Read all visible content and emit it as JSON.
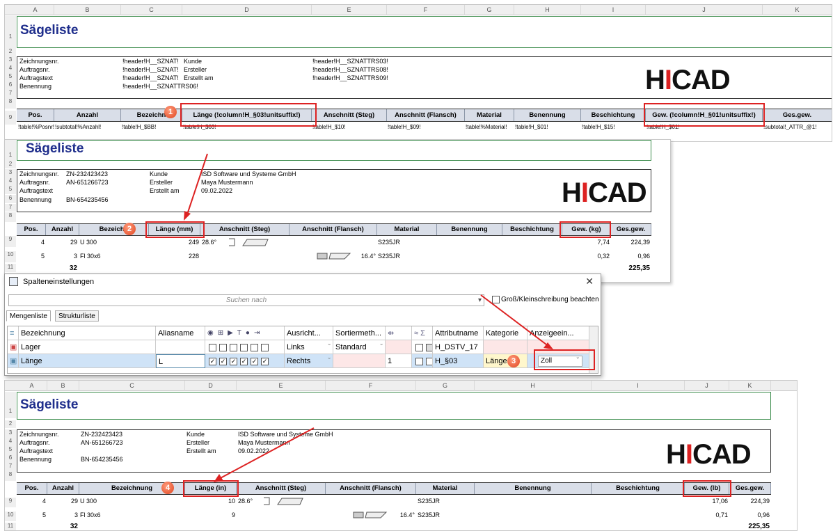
{
  "colors": {
    "title": "#1f2e8c",
    "red": "#dd2222",
    "header_bg": "#d9dee8"
  },
  "shot1": {
    "cols": [
      "A",
      "B",
      "C",
      "D",
      "E",
      "F",
      "G",
      "H",
      "I",
      "J",
      "K"
    ],
    "rownums": [
      "1",
      "2",
      "3",
      "4",
      "5",
      "6",
      "7",
      "8",
      "9"
    ],
    "title": "Sägeliste",
    "info": [
      [
        "Zeichnungsnr.",
        "!header!H__SZNAT!",
        "Kunde",
        "!header!H__SZNATTRS03!"
      ],
      [
        "Auftragsnr.",
        "!header!H__SZNAT!",
        "Ersteller",
        "!header!H__SZNATTRS08!"
      ],
      [
        "Auftragstext",
        "!header!H__SZNAT!",
        "Erstellt am",
        "!header!H__SZNATTRS09!"
      ],
      [
        "Benennung",
        "!header!H__SZNATTRS06!",
        "",
        ""
      ]
    ],
    "headers": [
      "Pos.",
      "Anzahl",
      "Bezeichn",
      "Länge (!column!H_§03!unitsuffix!)",
      "Anschnitt (Steg)",
      "Anschnitt (Flansch)",
      "Material",
      "Benennung",
      "Beschichtung",
      "Gew. (!column!H_§01!unitsuffix!)",
      "Ges.gew."
    ],
    "row9": [
      "!table!%Posnr!",
      "!subtotal!%Anzahl!",
      "!table!H_$BB!",
      "!table!H_$03!",
      "!table!H_$10!",
      "!table!H_$09!",
      "!table!%Material!",
      "!table!H_$01!",
      "!table!H_$15!",
      "!table!H_$01!",
      "!subtotal!_ATTR_@1!"
    ],
    "badge": "1"
  },
  "shot2": {
    "rownums": [
      "1",
      "2",
      "3",
      "4",
      "5",
      "6",
      "7",
      "8",
      "9",
      "10",
      "11"
    ],
    "title": "Sägeliste",
    "info": [
      [
        "Zeichnungsnr.",
        "ZN-232423423",
        "Kunde",
        "ISD Software und Systeme GmbH"
      ],
      [
        "Auftragsnr.",
        "AN-651266723",
        "Ersteller",
        "Maya Mustermann"
      ],
      [
        "Auftragstext",
        "",
        "Erstellt am",
        "09.02.2022"
      ],
      [
        "Benennung",
        "BN-654235456",
        "",
        ""
      ]
    ],
    "headers": [
      "Pos.",
      "Anzahl",
      "Bezeichn",
      "Länge (mm)",
      "Anschnitt (Steg)",
      "Anschnitt (Flansch)",
      "Material",
      "Benennung",
      "Beschichtung",
      "Gew. (kg)",
      "Ges.gew."
    ],
    "rows": [
      [
        "4",
        "29",
        "U 300",
        "249",
        "28.6°",
        "",
        "S235JR",
        "",
        "",
        "7,74",
        "224,39"
      ],
      [
        "5",
        "3",
        "Fl 30x6",
        "228",
        "",
        "16.4°",
        "S235JR",
        "",
        "",
        "0,32",
        "0,96"
      ]
    ],
    "total_count": "32",
    "total_weight": "225,35",
    "badge": "2"
  },
  "dialog": {
    "title": "Spalteneinstellungen",
    "search_placeholder": "Suchen nach",
    "case_label": "Groß/Kleinschreibung beachten",
    "tabs": [
      "Mengenliste",
      "Strukturliste"
    ],
    "columns": [
      "Bezeichnung",
      "Aliasname",
      "Ausricht...",
      "Sortiermeth...",
      "Attributname",
      "Kategorie",
      "Anzeigeein..."
    ],
    "rows": [
      {
        "name": "Lager",
        "alias": "",
        "align": "Links",
        "sort": "Standard",
        "width": "",
        "attr": "H_DSTV_17",
        "cat": "",
        "unit": ""
      },
      {
        "name": "Länge",
        "alias": "L",
        "align": "Rechts",
        "sort": "",
        "width": "1",
        "attr": "H_§03",
        "cat": "Länge",
        "unit": "Zoll"
      }
    ],
    "badge": "3"
  },
  "shot3": {
    "cols": [
      "A",
      "B",
      "C",
      "D",
      "E",
      "F",
      "G",
      "H",
      "I",
      "J",
      "K"
    ],
    "rownums": [
      "1",
      "2",
      "3",
      "4",
      "5",
      "6",
      "7",
      "8",
      "9",
      "10",
      "11"
    ],
    "title": "Sägeliste",
    "info": [
      [
        "Zeichnungsnr.",
        "ZN-232423423",
        "Kunde",
        "ISD Software und Systeme GmbH"
      ],
      [
        "Auftragsnr.",
        "AN-651266723",
        "Ersteller",
        "Maya Mustermann"
      ],
      [
        "Auftragstext",
        "",
        "Erstellt am",
        "09.02.2022"
      ],
      [
        "Benennung",
        "BN-654235456",
        "",
        ""
      ]
    ],
    "headers": [
      "Pos.",
      "Anzahl",
      "Bezeichnung",
      "Länge (in)",
      "Anschnitt (Steg)",
      "Anschnitt (Flansch)",
      "Material",
      "Benennung",
      "Beschichtung",
      "Gew. (lb)",
      "Ges.gew."
    ],
    "rows": [
      [
        "4",
        "29",
        "U 300",
        "10",
        "28.6°",
        "",
        "S235JR",
        "",
        "",
        "17,06",
        "224,39"
      ],
      [
        "5",
        "3",
        "Fl 30x6",
        "9",
        "",
        "16.4°",
        "S235JR",
        "",
        "",
        "0,71",
        "0,96"
      ]
    ],
    "total_count": "32",
    "total_weight": "225,35",
    "badge": "4"
  },
  "logo": {
    "text_h": "H",
    "text_i": "I",
    "text_cad": "CAD"
  }
}
